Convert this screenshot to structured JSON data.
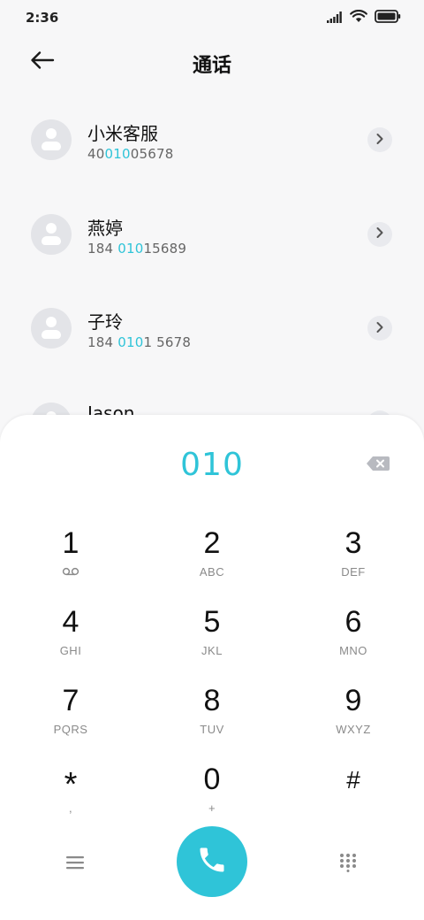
{
  "status_bar": {
    "time": "2:36",
    "icons": [
      "signal-icon",
      "wifi-icon",
      "battery-icon"
    ]
  },
  "header": {
    "title": "通话",
    "back_icon": "arrow-left-icon"
  },
  "contacts": [
    {
      "name": "小米客服",
      "number_parts": [
        "40",
        "010",
        "05678"
      ]
    },
    {
      "name": "燕婷",
      "number_parts": [
        "184 ",
        "010",
        "15689"
      ]
    },
    {
      "name": "子玲",
      "number_parts": [
        "184 ",
        "010",
        "1 5678"
      ]
    },
    {
      "name": "Jason",
      "number_parts": [
        "",
        "",
        ""
      ]
    }
  ],
  "dialer": {
    "number": "010",
    "backspace_icon": "backspace-icon"
  },
  "keypad": [
    {
      "digit": "1",
      "sub": "",
      "sub_icon": "voicemail-icon"
    },
    {
      "digit": "2",
      "sub": "ABC"
    },
    {
      "digit": "3",
      "sub": "DEF"
    },
    {
      "digit": "4",
      "sub": "GHI"
    },
    {
      "digit": "5",
      "sub": "JKL"
    },
    {
      "digit": "6",
      "sub": "MNO"
    },
    {
      "digit": "7",
      "sub": "PQRS"
    },
    {
      "digit": "8",
      "sub": "TUV"
    },
    {
      "digit": "9",
      "sub": "WXYZ"
    },
    {
      "digit": "*",
      "sub": ","
    },
    {
      "digit": "0",
      "sub": "+"
    },
    {
      "digit": "#",
      "sub": ""
    }
  ],
  "bottom_bar": {
    "menu_icon": "menu-icon",
    "call_icon": "phone-icon",
    "keypad_icon": "dialpad-icon"
  },
  "colors": {
    "accent": "#2fc4d8",
    "avatar_bg": "#e3e4e8"
  }
}
